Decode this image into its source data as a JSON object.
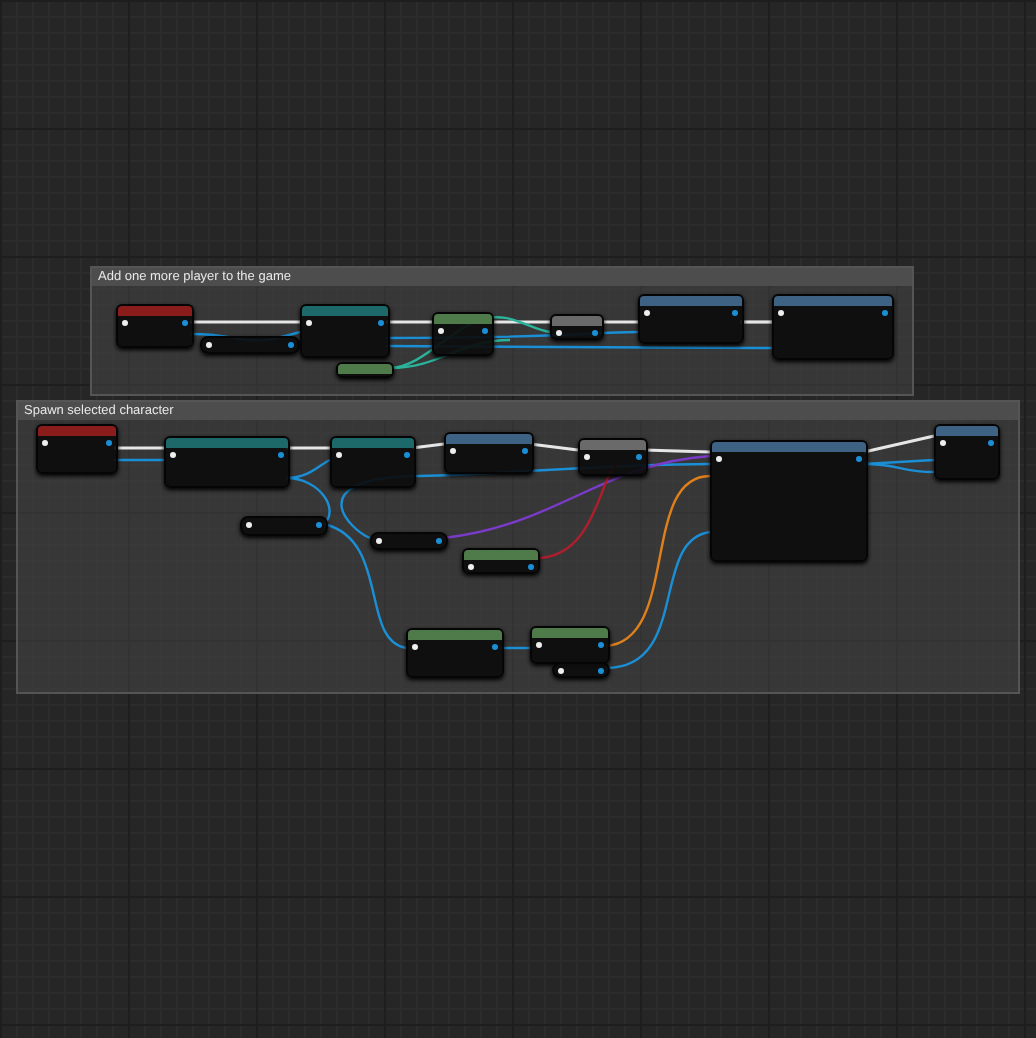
{
  "comments": [
    {
      "title": "Add one more player to the game",
      "nodes": [
        {
          "kind": "event"
        },
        {
          "kind": "variable"
        },
        {
          "kind": "cast"
        },
        {
          "kind": "pure"
        },
        {
          "kind": "pure"
        },
        {
          "kind": "macro"
        },
        {
          "kind": "function"
        },
        {
          "kind": "function"
        }
      ]
    },
    {
      "title": "Spawn selected character",
      "nodes": [
        {
          "kind": "event"
        },
        {
          "kind": "cast"
        },
        {
          "kind": "cast"
        },
        {
          "kind": "function"
        },
        {
          "kind": "macro"
        },
        {
          "kind": "function"
        },
        {
          "kind": "function"
        },
        {
          "kind": "variable"
        },
        {
          "kind": "variable"
        },
        {
          "kind": "pure"
        },
        {
          "kind": "pure"
        },
        {
          "kind": "pure"
        },
        {
          "kind": "variable"
        }
      ]
    }
  ]
}
